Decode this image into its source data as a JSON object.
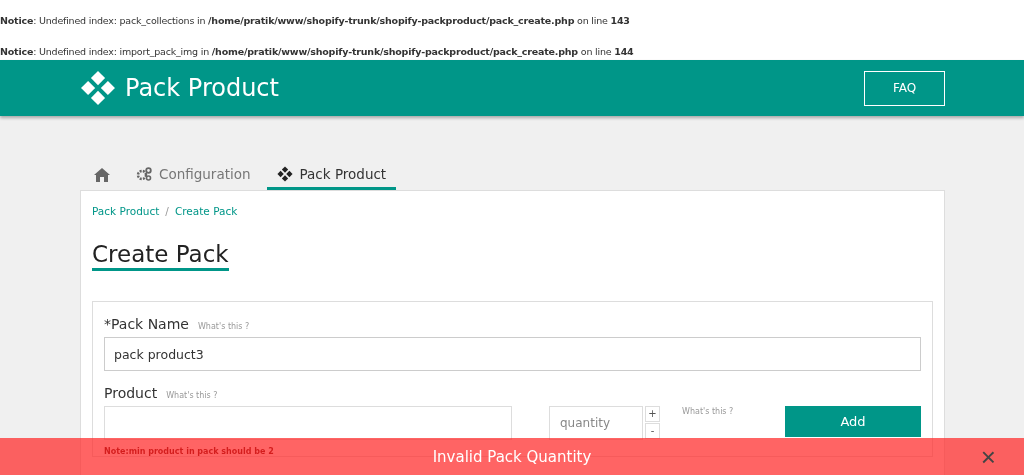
{
  "notices": [
    {
      "label": "Notice",
      "message": ": Undefined index: pack_collections in ",
      "path": "/home/pratik/www/shopify-trunk/shopify-packproduct/pack_create.php",
      "on_line": " on line ",
      "line": "143"
    },
    {
      "label": "Notice",
      "message": ": Undefined index: import_pack_img in ",
      "path": "/home/pratik/www/shopify-trunk/shopify-packproduct/pack_create.php",
      "on_line": " on line ",
      "line": "144"
    }
  ],
  "header": {
    "title": "Pack Product",
    "button": "FAQ"
  },
  "tabs": [
    {
      "kind": "home",
      "selected": false
    },
    {
      "kind": "config",
      "label": "Configuration",
      "selected": false
    },
    {
      "kind": "pack",
      "label": "Pack Product",
      "selected": true
    }
  ],
  "breadcrumb": [
    "Pack Product",
    "Create Pack"
  ],
  "breadcrumb_separator": "/",
  "heading": "Create Pack",
  "form": {
    "pack_name": {
      "label": "*Pack Name",
      "help": "What's this ?",
      "value": "pack product3"
    },
    "product": {
      "label": "Product",
      "help": "What's this ?",
      "quantity_placeholder": "quantity",
      "plus": "+",
      "minus": "-",
      "quantity_help": "What's this ?",
      "add": "Add",
      "note": "Note:min product in pack should be 2"
    }
  },
  "toast": {
    "message": "Invalid Pack Quantity",
    "close": "×"
  }
}
